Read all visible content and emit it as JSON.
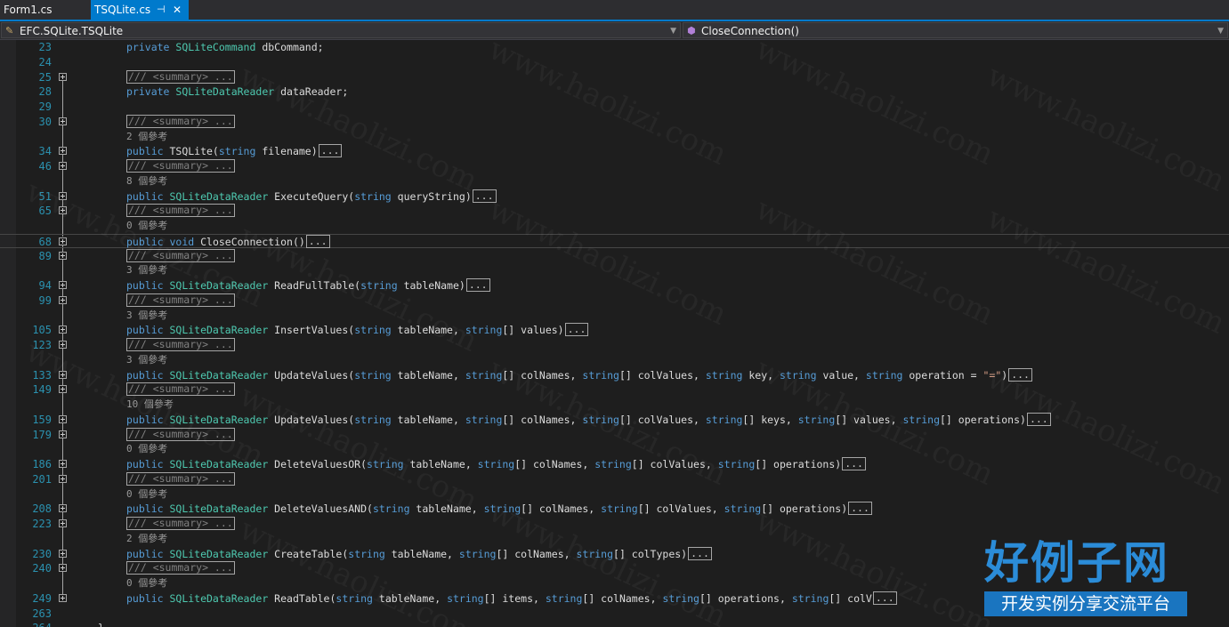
{
  "tabs": [
    {
      "label": "Form1.cs",
      "active": false
    },
    {
      "label": "TSQLite.cs",
      "active": true,
      "pin_glyph": "⊣",
      "close_glyph": "✕"
    }
  ],
  "nav": {
    "left_label": "EFC.SQLite.TSQLite",
    "right_label": "CloseConnection()"
  },
  "colors": {
    "accent": "#007acc",
    "keyword": "#569cd6",
    "type": "#4ec9b0",
    "string": "#d69d85",
    "line_number": "#2b91af",
    "comment": "#808080"
  },
  "editor": {
    "summary_text": "/// <summary> ...",
    "ellipsis_text": "...",
    "lines": [
      {
        "num": "23",
        "kind": "code",
        "parts": [
          [
            "kw",
            "private "
          ],
          [
            "ty",
            "SQLiteCommand"
          ],
          [
            "tx",
            " dbCommand;"
          ]
        ]
      },
      {
        "num": "24",
        "kind": "blank"
      },
      {
        "num": "25",
        "kind": "summary"
      },
      {
        "num": "28",
        "kind": "code",
        "parts": [
          [
            "kw",
            "private "
          ],
          [
            "ty",
            "SQLiteDataReader"
          ],
          [
            "tx",
            " dataReader;"
          ]
        ]
      },
      {
        "num": "29",
        "kind": "blank"
      },
      {
        "num": "30",
        "kind": "summary"
      },
      {
        "kind": "refs",
        "text": "2 個參考"
      },
      {
        "num": "34",
        "kind": "method",
        "parts": [
          [
            "kw",
            "public "
          ],
          [
            "tx",
            "TSQLite("
          ],
          [
            "kw",
            "string"
          ],
          [
            "tx",
            " filename)"
          ]
        ]
      },
      {
        "num": "46",
        "kind": "summary"
      },
      {
        "kind": "refs",
        "text": "8 個參考"
      },
      {
        "num": "51",
        "kind": "method",
        "parts": [
          [
            "kw",
            "public "
          ],
          [
            "ty",
            "SQLiteDataReader"
          ],
          [
            "tx",
            " ExecuteQuery("
          ],
          [
            "kw",
            "string"
          ],
          [
            "tx",
            " queryString)"
          ]
        ]
      },
      {
        "num": "65",
        "kind": "summary"
      },
      {
        "kind": "refs",
        "text": "0 個參考"
      },
      {
        "num": "68",
        "kind": "method",
        "current": true,
        "parts": [
          [
            "kw",
            "public "
          ],
          [
            "kw",
            "void"
          ],
          [
            "tx",
            " CloseConnection()"
          ]
        ]
      },
      {
        "num": "89",
        "kind": "summary"
      },
      {
        "kind": "refs",
        "text": "3 個參考"
      },
      {
        "num": "94",
        "kind": "method",
        "parts": [
          [
            "kw",
            "public "
          ],
          [
            "ty",
            "SQLiteDataReader"
          ],
          [
            "tx",
            " ReadFullTable("
          ],
          [
            "kw",
            "string"
          ],
          [
            "tx",
            " tableName)"
          ]
        ]
      },
      {
        "num": "99",
        "kind": "summary"
      },
      {
        "kind": "refs",
        "text": "3 個參考"
      },
      {
        "num": "105",
        "kind": "method",
        "parts": [
          [
            "kw",
            "public "
          ],
          [
            "ty",
            "SQLiteDataReader"
          ],
          [
            "tx",
            " InsertValues("
          ],
          [
            "kw",
            "string"
          ],
          [
            "tx",
            " tableName, "
          ],
          [
            "kw",
            "string"
          ],
          [
            "tx",
            "[] values)"
          ]
        ]
      },
      {
        "num": "123",
        "kind": "summary"
      },
      {
        "kind": "refs",
        "text": "3 個參考"
      },
      {
        "num": "133",
        "kind": "method",
        "parts": [
          [
            "kw",
            "public "
          ],
          [
            "ty",
            "SQLiteDataReader"
          ],
          [
            "tx",
            " UpdateValues("
          ],
          [
            "kw",
            "string"
          ],
          [
            "tx",
            " tableName, "
          ],
          [
            "kw",
            "string"
          ],
          [
            "tx",
            "[] colNames, "
          ],
          [
            "kw",
            "string"
          ],
          [
            "tx",
            "[] colValues, "
          ],
          [
            "kw",
            "string"
          ],
          [
            "tx",
            " key, "
          ],
          [
            "kw",
            "string"
          ],
          [
            "tx",
            " value, "
          ],
          [
            "kw",
            "string"
          ],
          [
            "tx",
            " operation = "
          ],
          [
            "st",
            "\"=\""
          ],
          [
            "tx",
            ")"
          ]
        ]
      },
      {
        "num": "149",
        "kind": "summary"
      },
      {
        "kind": "refs",
        "text": "10 個參考"
      },
      {
        "num": "159",
        "kind": "method",
        "parts": [
          [
            "kw",
            "public "
          ],
          [
            "ty",
            "SQLiteDataReader"
          ],
          [
            "tx",
            " UpdateValues("
          ],
          [
            "kw",
            "string"
          ],
          [
            "tx",
            " tableName, "
          ],
          [
            "kw",
            "string"
          ],
          [
            "tx",
            "[] colNames, "
          ],
          [
            "kw",
            "string"
          ],
          [
            "tx",
            "[] colValues, "
          ],
          [
            "kw",
            "string"
          ],
          [
            "tx",
            "[] keys, "
          ],
          [
            "kw",
            "string"
          ],
          [
            "tx",
            "[] values, "
          ],
          [
            "kw",
            "string"
          ],
          [
            "tx",
            "[] operations)"
          ]
        ]
      },
      {
        "num": "179",
        "kind": "summary"
      },
      {
        "kind": "refs",
        "text": "0 個參考"
      },
      {
        "num": "186",
        "kind": "method",
        "parts": [
          [
            "kw",
            "public "
          ],
          [
            "ty",
            "SQLiteDataReader"
          ],
          [
            "tx",
            " DeleteValuesOR("
          ],
          [
            "kw",
            "string"
          ],
          [
            "tx",
            " tableName, "
          ],
          [
            "kw",
            "string"
          ],
          [
            "tx",
            "[] colNames, "
          ],
          [
            "kw",
            "string"
          ],
          [
            "tx",
            "[] colValues, "
          ],
          [
            "kw",
            "string"
          ],
          [
            "tx",
            "[] operations)"
          ]
        ]
      },
      {
        "num": "201",
        "kind": "summary"
      },
      {
        "kind": "refs",
        "text": "0 個參考"
      },
      {
        "num": "208",
        "kind": "method",
        "parts": [
          [
            "kw",
            "public "
          ],
          [
            "ty",
            "SQLiteDataReader"
          ],
          [
            "tx",
            " DeleteValuesAND("
          ],
          [
            "kw",
            "string"
          ],
          [
            "tx",
            " tableName, "
          ],
          [
            "kw",
            "string"
          ],
          [
            "tx",
            "[] colNames, "
          ],
          [
            "kw",
            "string"
          ],
          [
            "tx",
            "[] colValues, "
          ],
          [
            "kw",
            "string"
          ],
          [
            "tx",
            "[] operations)"
          ]
        ]
      },
      {
        "num": "223",
        "kind": "summary"
      },
      {
        "kind": "refs",
        "text": "2 個參考"
      },
      {
        "num": "230",
        "kind": "method",
        "parts": [
          [
            "kw",
            "public "
          ],
          [
            "ty",
            "SQLiteDataReader"
          ],
          [
            "tx",
            " CreateTable("
          ],
          [
            "kw",
            "string"
          ],
          [
            "tx",
            " tableName, "
          ],
          [
            "kw",
            "string"
          ],
          [
            "tx",
            "[] colNames, "
          ],
          [
            "kw",
            "string"
          ],
          [
            "tx",
            "[] colTypes)"
          ]
        ]
      },
      {
        "num": "240",
        "kind": "summary"
      },
      {
        "kind": "refs",
        "text": "0 個參考"
      },
      {
        "num": "249",
        "kind": "method",
        "parts": [
          [
            "kw",
            "public "
          ],
          [
            "ty",
            "SQLiteDataReader"
          ],
          [
            "tx",
            " ReadTable("
          ],
          [
            "kw",
            "string"
          ],
          [
            "tx",
            " tableName, "
          ],
          [
            "kw",
            "string"
          ],
          [
            "tx",
            "[] items, "
          ],
          [
            "kw",
            "string"
          ],
          [
            "tx",
            "[] colNames, "
          ],
          [
            "kw",
            "string"
          ],
          [
            "tx",
            "[] operations, "
          ],
          [
            "kw",
            "string"
          ],
          [
            "tx",
            "[] colV"
          ]
        ]
      },
      {
        "num": "263",
        "kind": "blank"
      },
      {
        "num": "264",
        "kind": "brace",
        "text": "}"
      }
    ]
  },
  "watermark": {
    "site_text": "www.haolizi.com",
    "logo_title": "好例子网",
    "logo_subtitle": "开发实例分享交流平台"
  }
}
